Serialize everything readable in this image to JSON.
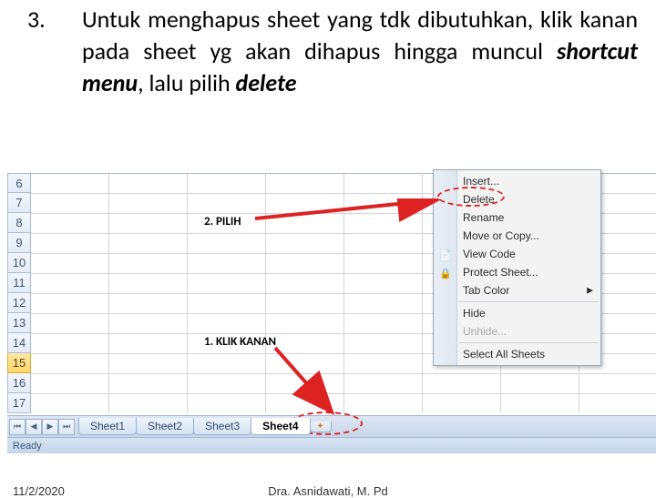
{
  "instruction": {
    "number": "3.",
    "text_1": "Untuk menghapus sheet yang tdk dibutuhkan, klik kanan pada sheet yg akan dihapus hingga muncul ",
    "term_1": "shortcut menu",
    "text_2": ", lalu pilih ",
    "term_2": "delete"
  },
  "rows": [
    "6",
    "7",
    "8",
    "9",
    "10",
    "11",
    "12",
    "13",
    "14",
    "15",
    "16",
    "17"
  ],
  "selected_row_index": 9,
  "cells": {
    "pilih": "2. PILIH",
    "klik_kanan": "1. KLIK KANAN"
  },
  "tabs": {
    "items": [
      "Sheet1",
      "Sheet2",
      "Sheet3",
      "Sheet4"
    ],
    "active_index": 3
  },
  "status": "Ready",
  "context_menu": {
    "insert": "Insert...",
    "delete": "Delete",
    "rename": "Rename",
    "move": "Move or Copy...",
    "viewcode": "View Code",
    "protect": "Protect Sheet...",
    "tabcolor": "Tab Color",
    "hide": "Hide",
    "unhide": "Unhide...",
    "selectall": "Select All Sheets"
  },
  "footer": {
    "date": "11/2/2020",
    "author": "Dra. Asnidawati, M. Pd"
  }
}
